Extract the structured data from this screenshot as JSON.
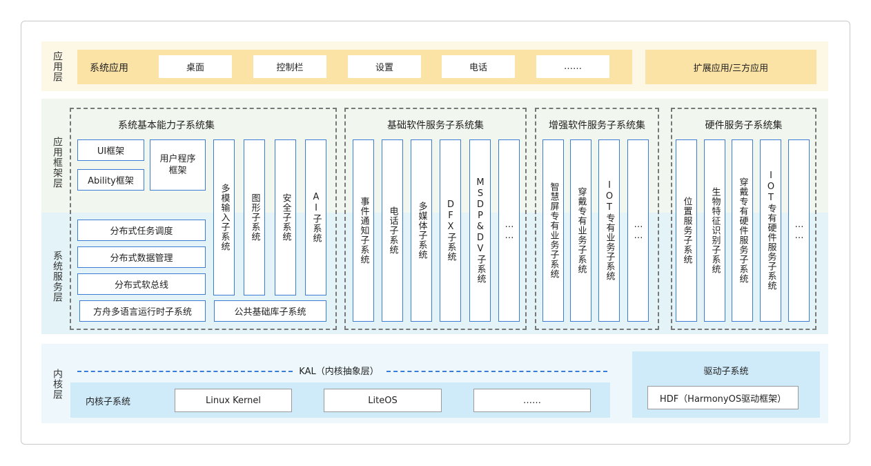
{
  "layers": {
    "app": "应用层",
    "framework": "应用框架层",
    "service": "系统服务层",
    "kernel": "内核层"
  },
  "app_layer": {
    "system_apps_label": "系统应用",
    "apps": [
      "桌面",
      "控制栏",
      "设置",
      "电话",
      "……"
    ],
    "extended": "扩展应用/三方应用"
  },
  "basic_capability": {
    "title": "系统基本能力子系统集",
    "ui_framework": "UI框架",
    "ability_framework": "Ability框架",
    "user_program_framework": "用户程序框架",
    "columns": [
      "多模输入子系统",
      "图形子系统",
      "安全子系统",
      "AI子系统"
    ],
    "distributed": [
      "分布式任务调度",
      "分布式数据管理",
      "分布式软总线"
    ],
    "ark_runtime": "方舟多语言运行时子系统",
    "common_lib": "公共基础库子系统"
  },
  "basic_software": {
    "title": "基础软件服务子系统集",
    "columns": [
      "事件通知子系统",
      "电话子系统",
      "多媒体子系统",
      "DFX子系统",
      "MSDP&DV子系统",
      "……"
    ]
  },
  "enhanced_software": {
    "title": "增强软件服务子系统集",
    "columns": [
      "智慧屏专有业务子系统",
      "穿戴专有业务子系统",
      "IOT专有业务子系统",
      "……"
    ]
  },
  "hardware_service": {
    "title": "硬件服务子系统集",
    "columns": [
      "位置服务子系统",
      "生物特征识别子系统",
      "穿戴专有硬件服务子系统",
      "IOT专有硬件服务子系统",
      "……"
    ]
  },
  "kernel_layer": {
    "kal": "KAL（内核抽象层）",
    "kernel_subsystem_label": "内核子系统",
    "kernels": [
      "Linux Kernel",
      "LiteOS",
      "……"
    ],
    "driver_subsystem": "驱动子系统",
    "hdf": "HDF（HarmonyOS驱动框架）"
  },
  "colors": {
    "app_band": "#fdf8e6",
    "app_bar": "#fbe3a6",
    "framework_band": "#f1f7ef",
    "service_band": "#e3f3f7",
    "kernel_band": "#eef8fc",
    "kernel_bar": "#cfeaf8",
    "accent": "#3a7bd5"
  }
}
